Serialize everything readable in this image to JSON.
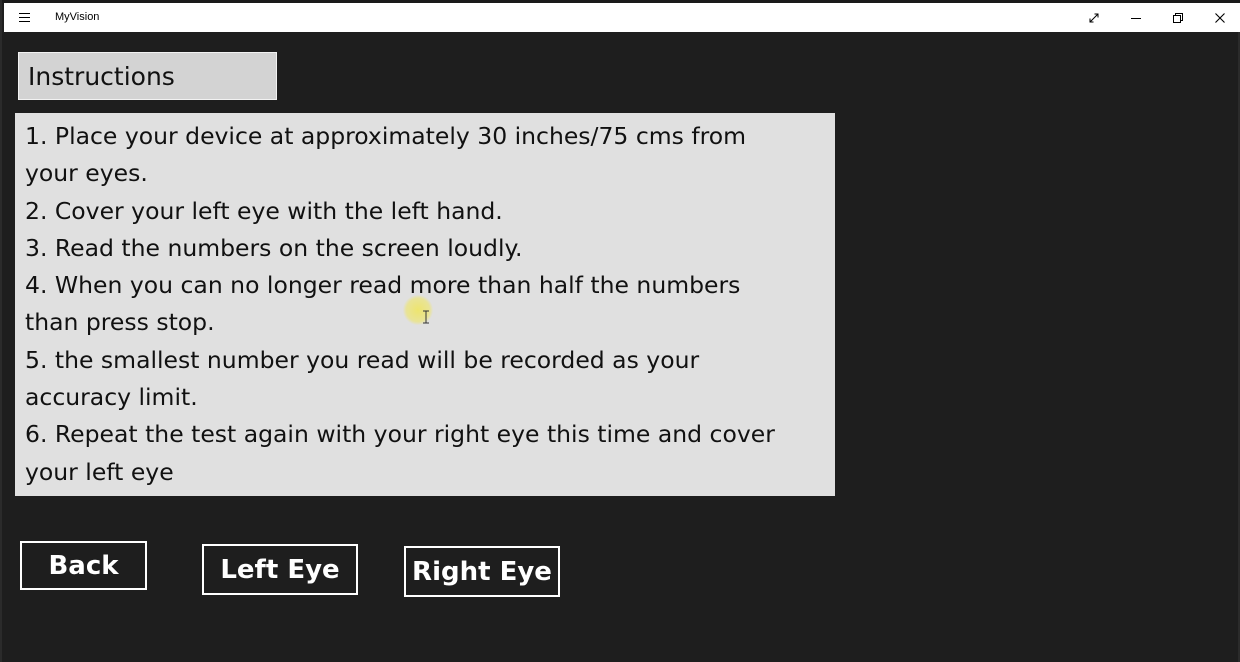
{
  "titlebar": {
    "menu_icon": "hamburger-icon",
    "app_title": "MyVision",
    "controls": [
      "expand-icon",
      "minimize-icon",
      "restore-icon",
      "close-icon"
    ]
  },
  "instructions": {
    "header": "Instructions",
    "lines": [
      "1. Place your device at approximately 30 inches/75 cms from",
      "your eyes.",
      "2. Cover your left eye with the left hand.",
      "3. Read the numbers on the screen loudly.",
      "4. When you can no longer read more than half the numbers",
      "than press stop.",
      "5. the smallest number you read will be recorded as your",
      "accuracy limit.",
      "6. Repeat the test again with your right eye this time and cover",
      "your left eye"
    ]
  },
  "buttons": {
    "back": "Back",
    "left_eye": "Left Eye",
    "right_eye": "Right Eye"
  },
  "colors": {
    "background": "#1e1e1e",
    "panel": "#e0e0e0",
    "header_panel": "#d3d3d3",
    "button_border": "#ffffff",
    "cursor_highlight": "#f0e65a"
  }
}
